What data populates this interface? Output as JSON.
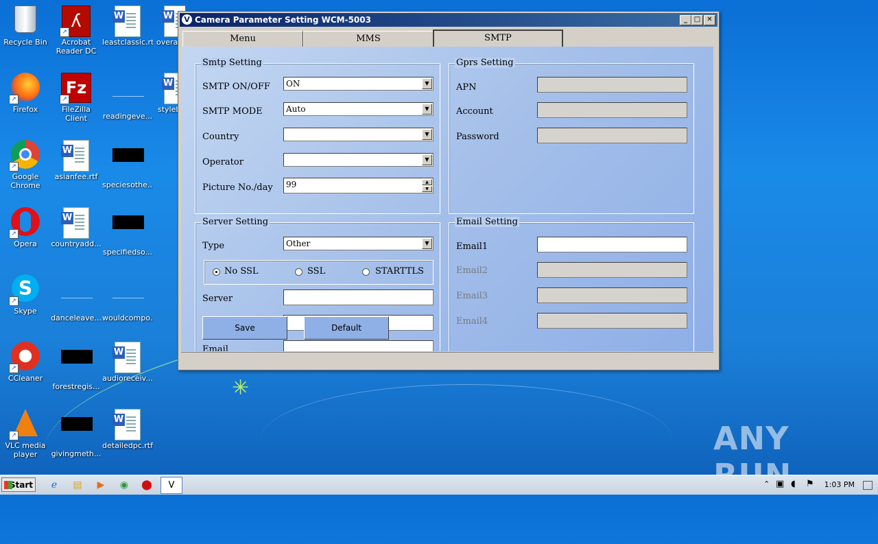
{
  "desktop": {
    "icons": [
      {
        "label": "Recycle Bin"
      },
      {
        "label": "Acrobat Reader DC"
      },
      {
        "label": "leastclassic.rtf"
      },
      {
        "label": "overal"
      },
      {
        "label": "Firefox"
      },
      {
        "label": "FileZilla Client"
      },
      {
        "label": "readingeve..."
      },
      {
        "label": "styleb"
      },
      {
        "label": "Google Chrome"
      },
      {
        "label": "asianfee.rtf"
      },
      {
        "label": "speciesothe..."
      },
      {
        "label": "Opera"
      },
      {
        "label": "countryadd..."
      },
      {
        "label": "specifiedso..."
      },
      {
        "label": "Skype"
      },
      {
        "label": "danceleave..."
      },
      {
        "label": "wouldcompo..."
      },
      {
        "label": "CCleaner"
      },
      {
        "label": "forestregis..."
      },
      {
        "label": "audioreceiv..."
      },
      {
        "label": "VLC media player"
      },
      {
        "label": "givingmeth..."
      },
      {
        "label": "detailedpc.rtf"
      }
    ]
  },
  "window": {
    "title": "Camera Parameter Setting WCM-5003",
    "controls": {
      "minimize": "_",
      "maximize": "□",
      "close": "✕"
    },
    "tabs": [
      {
        "label": "Menu"
      },
      {
        "label": "MMS"
      },
      {
        "label": "SMTP"
      }
    ]
  },
  "smtp_setting": {
    "legend": "Smtp Setting",
    "onoff_label": "SMTP ON/OFF",
    "onoff_value": "ON",
    "mode_label": "SMTP MODE",
    "mode_value": "Auto",
    "country_label": "Country",
    "country_value": "",
    "operator_label": "Operator",
    "operator_value": "",
    "picture_label": "Picture No./day",
    "picture_value": "99"
  },
  "gprs_setting": {
    "legend": "Gprs Setting",
    "apn_label": "APN",
    "account_label": "Account",
    "password_label": "Password"
  },
  "server_setting": {
    "legend": "Server Setting",
    "type_label": "Type",
    "type_value": "Other",
    "ssl_options": [
      "No SSL",
      "SSL",
      "STARTTLS"
    ],
    "server_label": "Server",
    "email_label": "Email"
  },
  "email_setting": {
    "legend": "Email Setting",
    "email1_label": "Email1",
    "email2_label": "Email2",
    "email3_label": "Email3",
    "email4_label": "Email4"
  },
  "buttons": {
    "save": "Save",
    "default": "Default"
  },
  "taskbar": {
    "start_label": "Start",
    "clock": "1:03 PM"
  },
  "watermark": "ANY RUN"
}
